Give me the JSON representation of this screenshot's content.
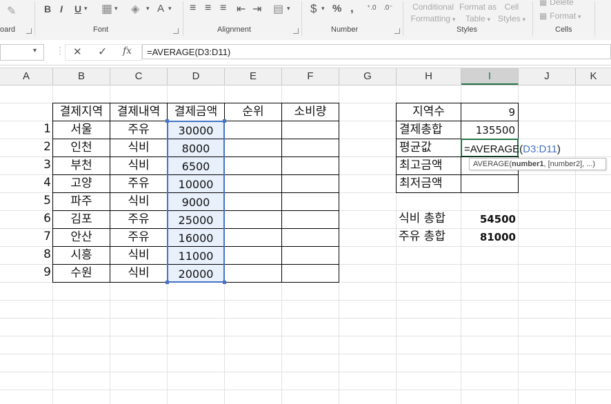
{
  "ribbon": {
    "clipboard_label": "oard",
    "font_label": "Font",
    "alignment_label": "Alignment",
    "number_label": "Number",
    "styles_label": "Styles",
    "cells_label": "Cells",
    "bold": "B",
    "italic": "I",
    "underline": "U",
    "font_color_glyph": "A",
    "currency_glyph": "$",
    "percent_glyph": "%",
    "comma_glyph": ",",
    "conditional_line1": "Conditional",
    "conditional_line2": "Formatting",
    "format_table_line1": "Format as",
    "format_table_line2": "Table",
    "cell_styles_line1": "Cell",
    "cell_styles_line2": "Styles",
    "delete_label": "Delete",
    "format_label": "Format"
  },
  "formula_bar": {
    "cancel_glyph": "✕",
    "enter_glyph": "✓",
    "fx_glyph": "fx",
    "formula": "=AVERAGE(D3:D11)"
  },
  "columns": [
    "A",
    "B",
    "C",
    "D",
    "E",
    "F",
    "G",
    "H",
    "I",
    "J",
    "K"
  ],
  "table": {
    "headers": [
      "결제지역",
      "결제내역",
      "결제금액",
      "순위",
      "소비량"
    ],
    "rows": [
      {
        "no": "1",
        "region": "서울",
        "type": "주유",
        "amount": "30000"
      },
      {
        "no": "2",
        "region": "인천",
        "type": "식비",
        "amount": "8000"
      },
      {
        "no": "3",
        "region": "부천",
        "type": "식비",
        "amount": "6500"
      },
      {
        "no": "4",
        "region": "고양",
        "type": "주유",
        "amount": "10000"
      },
      {
        "no": "5",
        "region": "파주",
        "type": "식비",
        "amount": "9000"
      },
      {
        "no": "6",
        "region": "김포",
        "type": "주유",
        "amount": "25000"
      },
      {
        "no": "7",
        "region": "안산",
        "type": "주유",
        "amount": "16000"
      },
      {
        "no": "8",
        "region": "시흥",
        "type": "식비",
        "amount": "11000"
      },
      {
        "no": "9",
        "region": "수원",
        "type": "식비",
        "amount": "20000"
      }
    ]
  },
  "summary": {
    "count_label": "지역수",
    "count_value": "9",
    "total_label": "결제총합",
    "total_value": "135500",
    "avg_label": "평균값",
    "avg_formula_prefix": "=AVERAGE(",
    "avg_formula_ref": "D3:D11",
    "avg_formula_suffix": ")",
    "max_label": "최고금액",
    "min_label": "최저금액",
    "food_label": "식비 총합",
    "food_value": "54500",
    "fuel_label": "주유 총합",
    "fuel_value": "81000"
  },
  "tooltip": {
    "fn": "AVERAGE(",
    "arg1": "number1",
    "rest": ", [number2], ...)"
  },
  "colors": {
    "accent_green": "#217346",
    "ref_blue": "#4472c4",
    "range_fill": "#e8f0fb"
  }
}
